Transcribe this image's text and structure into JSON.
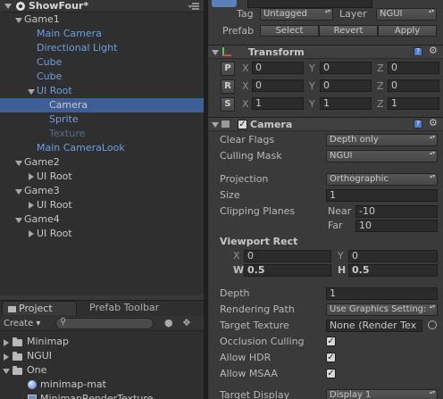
{
  "hierarchy": {
    "scene_title": "ShowFour*",
    "items": [
      {
        "label": "Game1"
      },
      {
        "label": "Main Camera"
      },
      {
        "label": "Directional Light"
      },
      {
        "label": "Cube"
      },
      {
        "label": "Cube"
      },
      {
        "label": "UI Root"
      },
      {
        "label": "Camera"
      },
      {
        "label": "Sprite"
      },
      {
        "label": "Texture"
      },
      {
        "label": "Main CameraLook"
      },
      {
        "label": "Game2"
      },
      {
        "label": "UI Root"
      },
      {
        "label": "Game3"
      },
      {
        "label": "UI Root"
      },
      {
        "label": "Game4"
      },
      {
        "label": "UI Root"
      }
    ]
  },
  "project": {
    "tabs": [
      {
        "label": "Project"
      },
      {
        "label": "Prefab Toolbar"
      }
    ],
    "create_label": "Create",
    "items": [
      {
        "label": "Minimap",
        "icon": "folder-icon"
      },
      {
        "label": "NGUI",
        "icon": "folder-icon"
      },
      {
        "label": "One",
        "icon": "folder-icon"
      },
      {
        "label": "minimap-mat",
        "icon": "material-sphere-icon"
      },
      {
        "label": "MinimapRenderTexture",
        "icon": "render-texture-icon"
      }
    ]
  },
  "inspector": {
    "tag_label": "Tag",
    "tag_value": "Untagged",
    "layer_label": "Layer",
    "layer_value": "NGUI",
    "prefab_label": "Prefab",
    "prefab_buttons": [
      "Select",
      "Revert",
      "Apply"
    ],
    "transform": {
      "title": "Transform",
      "rows": [
        {
          "btn": "P",
          "x": "0",
          "y": "0",
          "z": "0"
        },
        {
          "btn": "R",
          "x": "0",
          "y": "0",
          "z": "0"
        },
        {
          "btn": "S",
          "x": "1",
          "y": "1",
          "z": "1"
        }
      ],
      "axis_x": "X",
      "axis_y": "Y",
      "axis_z": "Z"
    },
    "camera": {
      "title": "Camera",
      "clear_flags_label": "Clear Flags",
      "clear_flags_value": "Depth only",
      "culling_mask_label": "Culling Mask",
      "culling_mask_value": "NGUI",
      "projection_label": "Projection",
      "projection_value": "Orthographic",
      "size_label": "Size",
      "size_value": "1",
      "clipping_label": "Clipping Planes",
      "near_label": "Near",
      "near_value": "-10",
      "far_label": "Far",
      "far_value": "10",
      "viewport_label": "Viewport Rect",
      "vp_x_label": "X",
      "vp_x_value": "0",
      "vp_y_label": "Y",
      "vp_y_value": "0",
      "vp_w_label": "W",
      "vp_w_value": "0.5",
      "vp_h_label": "H",
      "vp_h_value": "0.5",
      "depth_label": "Depth",
      "depth_value": "1",
      "rendering_path_label": "Rendering Path",
      "rendering_path_value": "Use Graphics Setting:",
      "target_texture_label": "Target Texture",
      "target_texture_value": "None (Render Tex",
      "occlusion_label": "Occlusion Culling",
      "hdr_label": "Allow HDR",
      "msaa_label": "Allow MSAA",
      "target_display_label": "Target Display",
      "target_display_value": "Display 1"
    }
  }
}
